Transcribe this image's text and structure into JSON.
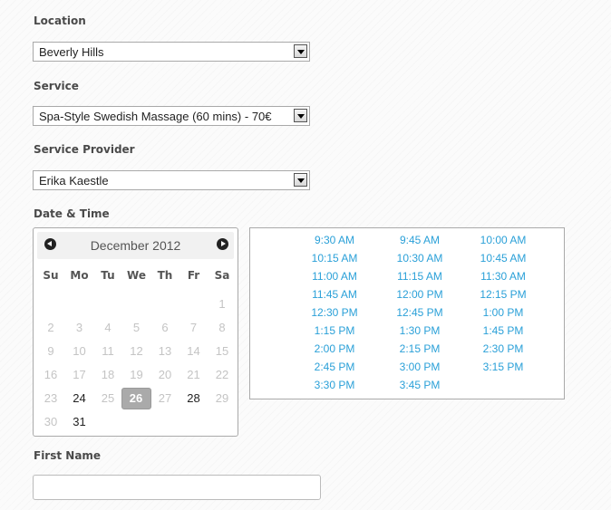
{
  "location": {
    "label": "Location",
    "value": "Beverly Hills"
  },
  "service": {
    "label": "Service",
    "value": "Spa-Style Swedish Massage (60 mins) - 70€"
  },
  "provider": {
    "label": "Service Provider",
    "value": "Erika Kaestle"
  },
  "datetime": {
    "label": "Date & Time"
  },
  "calendar": {
    "month_title": "December 2012",
    "prev_icon": "chevron-left-icon",
    "next_icon": "chevron-right-icon",
    "weekdays": [
      "Su",
      "Mo",
      "Tu",
      "We",
      "Th",
      "Fr",
      "Sa"
    ],
    "weeks": [
      [
        null,
        null,
        null,
        null,
        null,
        null,
        "1"
      ],
      [
        "2",
        "3",
        "4",
        "5",
        "6",
        "7",
        "8"
      ],
      [
        "9",
        "10",
        "11",
        "12",
        "13",
        "14",
        "15"
      ],
      [
        "16",
        "17",
        "18",
        "19",
        "20",
        "21",
        "22"
      ],
      [
        "23",
        "24",
        "25",
        "26",
        "27",
        "28",
        "29"
      ],
      [
        "30",
        "31",
        null,
        null,
        null,
        null,
        null
      ]
    ],
    "available_days": [
      "24",
      "26",
      "28",
      "31"
    ],
    "selected_day": "26",
    "colors": {
      "selected_bg": "#aaaaaa",
      "active_text": "#222222",
      "inactive_text": "#c4c4c4"
    }
  },
  "time_slots": [
    [
      "9:30 AM",
      "9:45 AM",
      "10:00 AM"
    ],
    [
      "10:15 AM",
      "10:30 AM",
      "10:45 AM"
    ],
    [
      "11:00 AM",
      "11:15 AM",
      "11:30 AM"
    ],
    [
      "11:45 AM",
      "12:00 PM",
      "12:15 PM"
    ],
    [
      "12:30 PM",
      "12:45 PM",
      "1:00 PM"
    ],
    [
      "1:15 PM",
      "1:30 PM",
      "1:45 PM"
    ],
    [
      "2:00 PM",
      "2:15 PM",
      "2:30 PM"
    ],
    [
      "2:45 PM",
      "3:00 PM",
      "3:15 PM"
    ],
    [
      "3:30 PM",
      "3:45 PM"
    ]
  ],
  "time_slot_color": "#2aa0d8",
  "first_name": {
    "label": "First Name",
    "value": ""
  }
}
